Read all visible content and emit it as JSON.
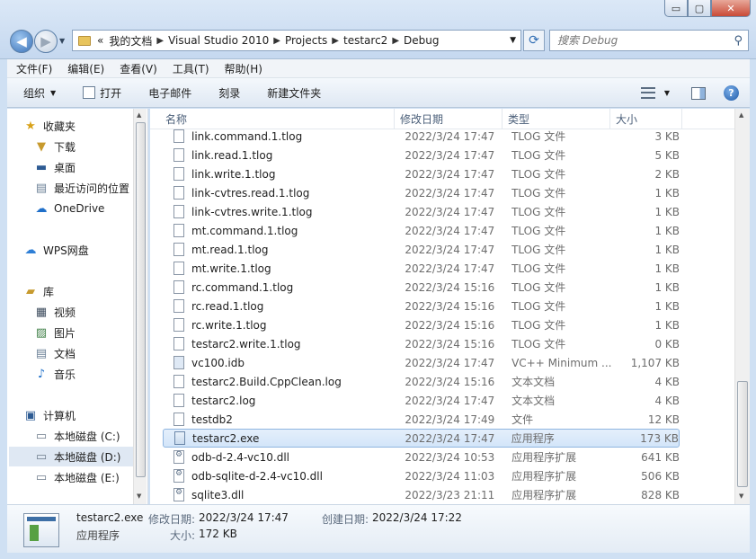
{
  "window": {
    "minimize": "▭",
    "maximize": "▢",
    "close": "✕"
  },
  "address": {
    "prefix": "«",
    "crumbs": [
      "我的文档",
      "Visual Studio 2010",
      "Projects",
      "testarc2",
      "Debug"
    ],
    "search_placeholder": "搜索 Debug"
  },
  "menu": [
    "文件(F)",
    "编辑(E)",
    "查看(V)",
    "工具(T)",
    "帮助(H)"
  ],
  "toolbar": {
    "organize": "组织",
    "open": "打开",
    "email": "电子邮件",
    "burn": "刻录",
    "new_folder": "新建文件夹"
  },
  "nav": {
    "favorites": "收藏夹",
    "downloads": "下载",
    "desktop": "桌面",
    "recent": "最近访问的位置",
    "onedrive": "OneDrive",
    "wps": "WPS网盘",
    "libraries": "库",
    "videos": "视频",
    "pictures": "图片",
    "documents": "文档",
    "music": "音乐",
    "computer": "计算机",
    "drive_c": "本地磁盘 (C:)",
    "drive_d": "本地磁盘 (D:)",
    "drive_e": "本地磁盘 (E:)"
  },
  "columns": {
    "name": "名称",
    "date": "修改日期",
    "type": "类型",
    "size": "大小"
  },
  "files": [
    {
      "name": "link.command.1.tlog",
      "date": "2022/3/24 17:47",
      "type": "TLOG 文件",
      "size": "3 KB",
      "icon": "file"
    },
    {
      "name": "link.read.1.tlog",
      "date": "2022/3/24 17:47",
      "type": "TLOG 文件",
      "size": "5 KB",
      "icon": "file"
    },
    {
      "name": "link.write.1.tlog",
      "date": "2022/3/24 17:47",
      "type": "TLOG 文件",
      "size": "2 KB",
      "icon": "file"
    },
    {
      "name": "link-cvtres.read.1.tlog",
      "date": "2022/3/24 17:47",
      "type": "TLOG 文件",
      "size": "1 KB",
      "icon": "file"
    },
    {
      "name": "link-cvtres.write.1.tlog",
      "date": "2022/3/24 17:47",
      "type": "TLOG 文件",
      "size": "1 KB",
      "icon": "file"
    },
    {
      "name": "mt.command.1.tlog",
      "date": "2022/3/24 17:47",
      "type": "TLOG 文件",
      "size": "1 KB",
      "icon": "file"
    },
    {
      "name": "mt.read.1.tlog",
      "date": "2022/3/24 17:47",
      "type": "TLOG 文件",
      "size": "1 KB",
      "icon": "file"
    },
    {
      "name": "mt.write.1.tlog",
      "date": "2022/3/24 17:47",
      "type": "TLOG 文件",
      "size": "1 KB",
      "icon": "file"
    },
    {
      "name": "rc.command.1.tlog",
      "date": "2022/3/24 15:16",
      "type": "TLOG 文件",
      "size": "1 KB",
      "icon": "file"
    },
    {
      "name": "rc.read.1.tlog",
      "date": "2022/3/24 15:16",
      "type": "TLOG 文件",
      "size": "1 KB",
      "icon": "file"
    },
    {
      "name": "rc.write.1.tlog",
      "date": "2022/3/24 15:16",
      "type": "TLOG 文件",
      "size": "1 KB",
      "icon": "file"
    },
    {
      "name": "testarc2.write.1.tlog",
      "date": "2022/3/24 15:16",
      "type": "TLOG 文件",
      "size": "0 KB",
      "icon": "file"
    },
    {
      "name": "vc100.idb",
      "date": "2022/3/24 17:47",
      "type": "VC++ Minimum ...",
      "size": "1,107 KB",
      "icon": "idb"
    },
    {
      "name": "testarc2.Build.CppClean.log",
      "date": "2022/3/24 15:16",
      "type": "文本文档",
      "size": "4 KB",
      "icon": "file"
    },
    {
      "name": "testarc2.log",
      "date": "2022/3/24 17:47",
      "type": "文本文档",
      "size": "4 KB",
      "icon": "file"
    },
    {
      "name": "testdb2",
      "date": "2022/3/24 17:49",
      "type": "文件",
      "size": "12 KB",
      "icon": "file"
    },
    {
      "name": "testarc2.exe",
      "date": "2022/3/24 17:47",
      "type": "应用程序",
      "size": "173 KB",
      "icon": "exe"
    },
    {
      "name": "odb-d-2.4-vc10.dll",
      "date": "2022/3/24 10:53",
      "type": "应用程序扩展",
      "size": "641 KB",
      "icon": "dll"
    },
    {
      "name": "odb-sqlite-d-2.4-vc10.dll",
      "date": "2022/3/24 11:03",
      "type": "应用程序扩展",
      "size": "506 KB",
      "icon": "dll"
    },
    {
      "name": "sqlite3.dll",
      "date": "2022/3/23 21:11",
      "type": "应用程序扩展",
      "size": "828 KB",
      "icon": "dll"
    }
  ],
  "details": {
    "name": "testarc2.exe",
    "kind": "应用程序",
    "modified_label": "修改日期:",
    "modified": "2022/3/24 17:47",
    "created_label": "创建日期:",
    "created": "2022/3/24 17:22",
    "size_label": "大小:",
    "size": "172 KB"
  }
}
